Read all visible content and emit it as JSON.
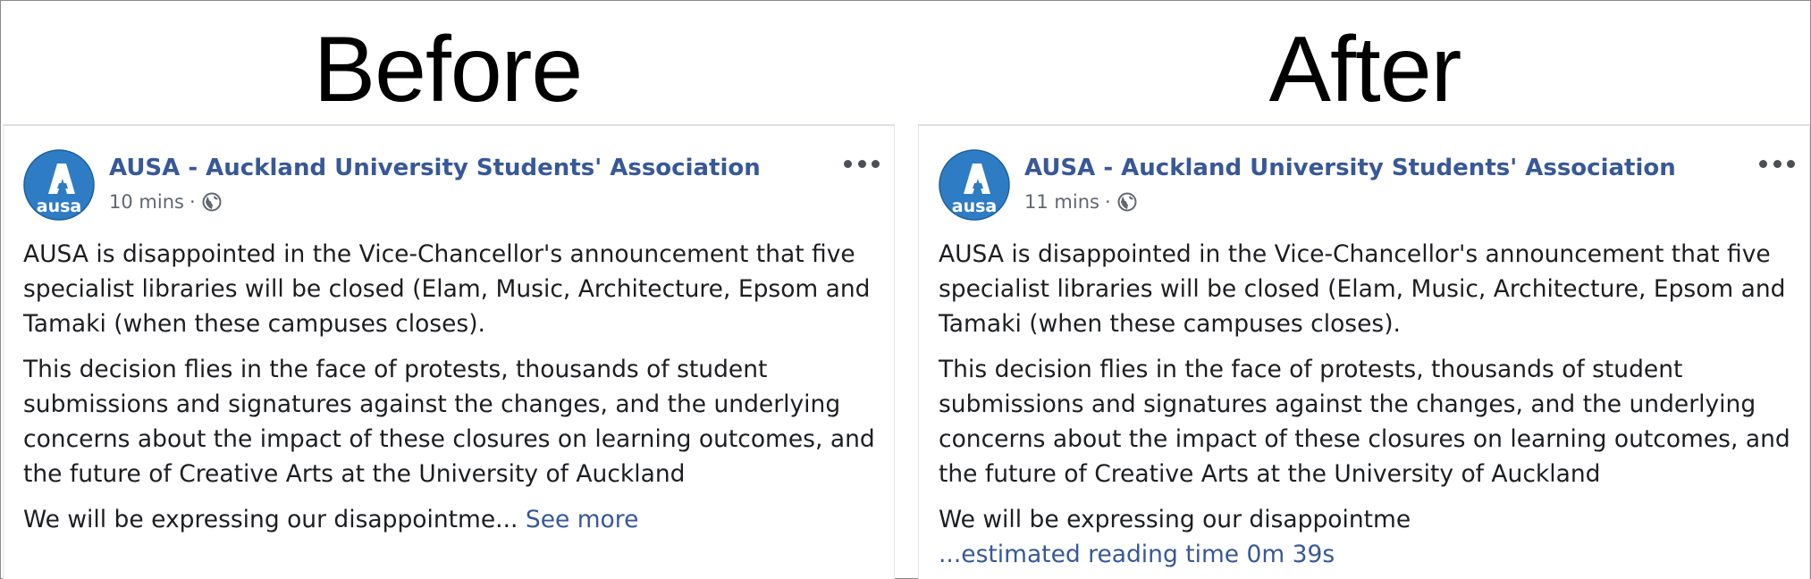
{
  "headings": {
    "before": "Before",
    "after": "After"
  },
  "panels": {
    "before": {
      "page_name": "AUSA - Auckland University Students' Association",
      "avatar_text": "ausa",
      "timestamp": "10 mins",
      "separator": "·",
      "paragraphs": [
        "AUSA is disappointed in the Vice-Chancellor's announcement that five specialist libraries will be closed (Elam, Music, Architecture, Epsom and Tamaki (when these campuses closes).",
        "This decision flies in the face of protests, thousands of student submissions and signatures against the changes, and the underlying concerns about the impact of these closures on learning outcomes, and the future of Creative Arts at the University of Auckland"
      ],
      "truncated_text": "We will be expressing our disappointme...",
      "see_more": "See more"
    },
    "after": {
      "page_name": "AUSA - Auckland University Students' Association",
      "avatar_text": "ausa",
      "timestamp": "11 mins",
      "separator": "·",
      "paragraphs": [
        "AUSA is disappointed in the Vice-Chancellor's announcement that five specialist libraries will be closed (Elam, Music, Architecture, Epsom and Tamaki (when these campuses closes).",
        "This decision flies in the face of protests, thousands of student submissions and signatures against the changes, and the underlying concerns about the impact of these closures on learning outcomes, and the future of Creative Arts at the University of Auckland"
      ],
      "truncated_text": "We will be expressing our disappointme",
      "reading_time_link": "...estimated reading time 0m 39s"
    }
  },
  "icons": {
    "avatar": "ausa-logo-icon",
    "privacy": "globe-icon",
    "menu": "more-options-icon"
  },
  "colors": {
    "link": "#385898",
    "page_name": "#385898",
    "meta": "#606770",
    "body": "#1c1e21",
    "avatar_bg": "#2e7cc4"
  }
}
